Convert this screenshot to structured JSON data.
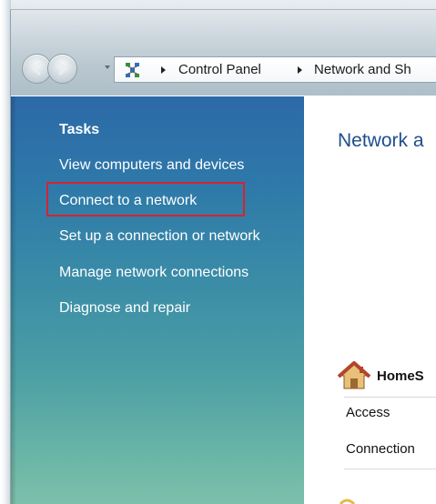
{
  "breadcrumb": {
    "items": [
      "Control Panel",
      "Network and Sh"
    ]
  },
  "sidebar": {
    "heading": "Tasks",
    "links": [
      "View computers and devices",
      "Connect to a network",
      "Set up a connection or network",
      "Manage network connections",
      "Diagnose and repair"
    ],
    "highlighted_index": 1
  },
  "main": {
    "title": "Network a",
    "network_name": "HomeS",
    "rows": [
      "Access",
      "Connection"
    ]
  },
  "icons": {
    "back": "back-arrow-icon",
    "forward": "forward-arrow-icon",
    "control_panel": "network-center-icon",
    "home": "home-icon"
  },
  "colors": {
    "sidebar_top": "#2c69a8",
    "sidebar_bottom": "#7cc0aa",
    "title_blue": "#1f4e8a",
    "highlight_red": "#d5242f"
  }
}
